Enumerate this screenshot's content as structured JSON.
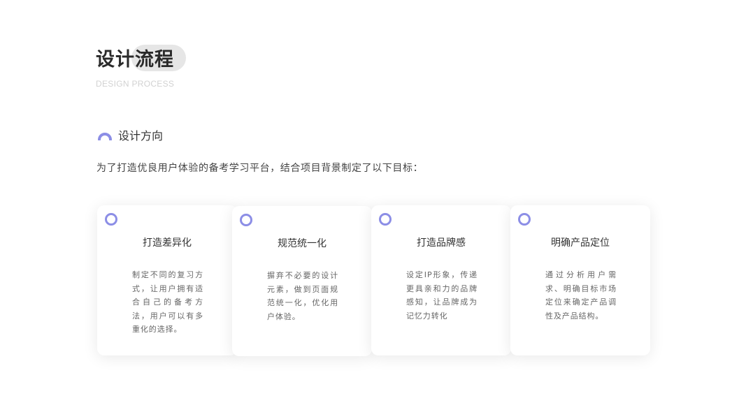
{
  "header": {
    "title": "设计流程",
    "subtitle": "DESIGN PROCESS"
  },
  "section": {
    "icon": "arc-icon",
    "title": "设计方向",
    "intro": "为了打造优良用户体验的备考学习平台，结合项目背景制定了以下目标："
  },
  "colors": {
    "accent": "#8c8ee6",
    "title_pill": "#e6e6e6"
  },
  "cards": [
    {
      "title": "打造差异化",
      "desc": "制定不同的复习方式，让用户拥有适合自己的备考方法，用户可以有多重化的选择。"
    },
    {
      "title": "规范统一化",
      "desc": "摒弃不必要的设计元素，做到页面规范统一化，优化用户体验。"
    },
    {
      "title": "打造品牌感",
      "desc": "设定IP形象，传递更具亲和力的品牌感知，让品牌成为记忆力转化"
    },
    {
      "title": "明确产品定位",
      "desc": "通过分析用户需求、明确目标市场定位来确定产品调性及产品结构。"
    }
  ]
}
